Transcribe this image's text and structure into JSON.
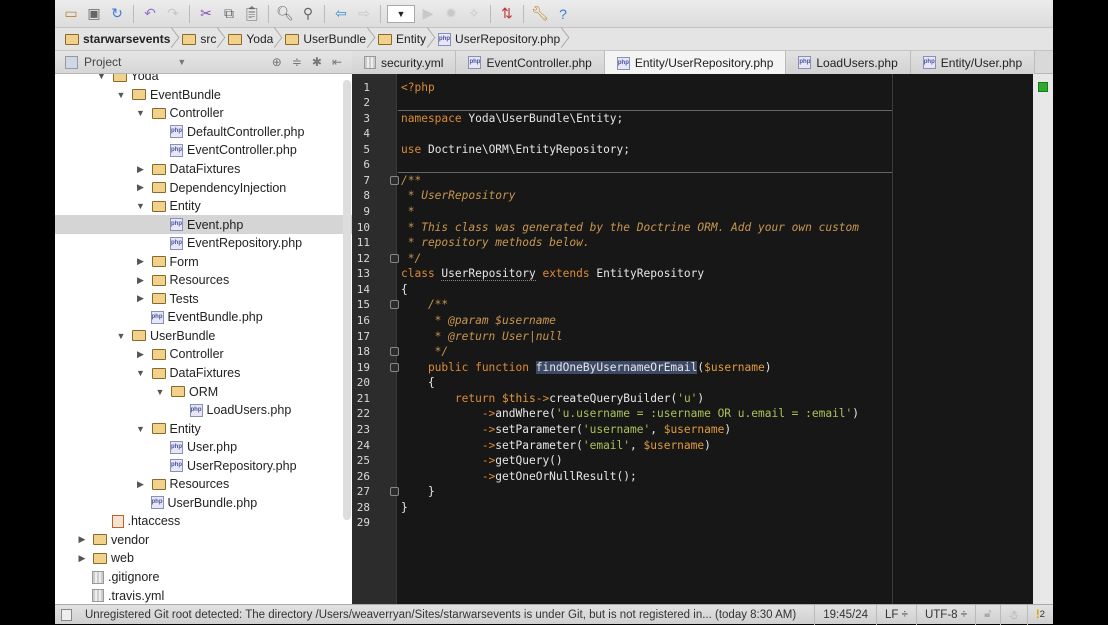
{
  "toolbar": {
    "icons": [
      "open-folder",
      "save",
      "sync",
      "undo",
      "redo",
      "cut",
      "copy",
      "paste",
      "find",
      "replace",
      "back",
      "forward",
      "run-config",
      "run",
      "debug",
      "coverage",
      "vcs",
      "settings",
      "help"
    ]
  },
  "breadcrumbs": [
    "starwarsevents",
    "src",
    "Yoda",
    "UserBundle",
    "Entity",
    "UserRepository.php"
  ],
  "project": {
    "label": "Project"
  },
  "tabs": [
    {
      "label": "security.yml",
      "type": "yml"
    },
    {
      "label": "EventController.php",
      "type": "php"
    },
    {
      "label": "Entity/UserRepository.php",
      "type": "php",
      "active": true
    },
    {
      "label": "LoadUsers.php",
      "type": "php"
    },
    {
      "label": "Entity/User.php",
      "type": "php"
    }
  ],
  "tree": [
    {
      "label": "Yoda",
      "depth": 1,
      "folder": true,
      "open": true
    },
    {
      "label": "EventBundle",
      "depth": 2,
      "folder": true,
      "open": true
    },
    {
      "label": "Controller",
      "depth": 3,
      "folder": true,
      "open": true
    },
    {
      "label": "DefaultController.php",
      "depth": 4
    },
    {
      "label": "EventController.php",
      "depth": 4
    },
    {
      "label": "DataFixtures",
      "depth": 3,
      "folder": true
    },
    {
      "label": "DependencyInjection",
      "depth": 3,
      "folder": true
    },
    {
      "label": "Entity",
      "depth": 3,
      "folder": true,
      "open": true
    },
    {
      "label": "Event.php",
      "depth": 4,
      "selected": true
    },
    {
      "label": "EventRepository.php",
      "depth": 4
    },
    {
      "label": "Form",
      "depth": 3,
      "folder": true
    },
    {
      "label": "Resources",
      "depth": 3,
      "folder": true
    },
    {
      "label": "Tests",
      "depth": 3,
      "folder": true
    },
    {
      "label": "EventBundle.php",
      "depth": 3
    },
    {
      "label": "UserBundle",
      "depth": 2,
      "folder": true,
      "open": true
    },
    {
      "label": "Controller",
      "depth": 3,
      "folder": true
    },
    {
      "label": "DataFixtures",
      "depth": 3,
      "folder": true,
      "open": true
    },
    {
      "label": "ORM",
      "depth": 4,
      "folder": true,
      "open": true
    },
    {
      "label": "LoadUsers.php",
      "depth": 5
    },
    {
      "label": "Entity",
      "depth": 3,
      "folder": true,
      "open": true
    },
    {
      "label": "User.php",
      "depth": 4
    },
    {
      "label": "UserRepository.php",
      "depth": 4
    },
    {
      "label": "Resources",
      "depth": 3,
      "folder": true
    },
    {
      "label": "UserBundle.php",
      "depth": 3
    },
    {
      "label": ".htaccess",
      "depth": 1,
      "kind": "htaccess"
    },
    {
      "label": "vendor",
      "depth": 0,
      "folder": true
    },
    {
      "label": "web",
      "depth": 0,
      "folder": true
    },
    {
      "label": ".gitignore",
      "depth": 0,
      "kind": "text"
    },
    {
      "label": ".travis.yml",
      "depth": 0,
      "kind": "text"
    }
  ],
  "code": [
    [
      [
        "<?php",
        "kw"
      ]
    ],
    [],
    [
      [
        "namespace ",
        "kw"
      ],
      [
        "Yoda\\UserBundle\\Entity;",
        ""
      ]
    ],
    [],
    [
      [
        "use ",
        "kw"
      ],
      [
        "Doctrine\\ORM\\EntityRepository;",
        ""
      ]
    ],
    [],
    [
      [
        "/**",
        "cm"
      ]
    ],
    [
      [
        " * UserRepository",
        "cm"
      ]
    ],
    [
      [
        " *",
        "cm"
      ]
    ],
    [
      [
        " * This class was generated by the Doctrine ORM. Add your own custom",
        "cm"
      ]
    ],
    [
      [
        " * repository methods below.",
        "cm"
      ]
    ],
    [
      [
        " */",
        "cm"
      ]
    ],
    [
      [
        "class ",
        "kw"
      ],
      [
        "UserRepository",
        "und"
      ],
      [
        " extends ",
        "kw"
      ],
      [
        "EntityRepository",
        ""
      ]
    ],
    [
      [
        "{",
        ""
      ]
    ],
    [
      [
        "    /**",
        "cm"
      ]
    ],
    [
      [
        "     * @param $username",
        "cm"
      ]
    ],
    [
      [
        "     * @return User|null",
        "cm"
      ]
    ],
    [
      [
        "     */",
        "cm"
      ]
    ],
    [
      [
        "    public function ",
        "kw"
      ],
      [
        "findOneByUsernameOrEmail",
        "hl"
      ],
      [
        "(",
        ""
      ],
      [
        "$username",
        "var"
      ],
      [
        ")",
        ""
      ]
    ],
    [
      [
        "    {",
        ""
      ]
    ],
    [
      [
        "        return ",
        "kw"
      ],
      [
        "$this",
        "var"
      ],
      [
        "->",
        "kw"
      ],
      [
        "createQueryBuilder(",
        ""
      ],
      [
        "'u'",
        "st"
      ],
      [
        ")",
        ""
      ]
    ],
    [
      [
        "            ->",
        "kw"
      ],
      [
        "andWhere(",
        ""
      ],
      [
        "'u.username = :username OR u.email = :email'",
        "st"
      ],
      [
        ")",
        ""
      ]
    ],
    [
      [
        "            ->",
        "kw"
      ],
      [
        "setParameter(",
        ""
      ],
      [
        "'username'",
        "st"
      ],
      [
        ", ",
        ""
      ],
      [
        "$username",
        "var"
      ],
      [
        ")",
        ""
      ]
    ],
    [
      [
        "            ->",
        "kw"
      ],
      [
        "setParameter(",
        ""
      ],
      [
        "'email'",
        "st"
      ],
      [
        ", ",
        ""
      ],
      [
        "$username",
        "var"
      ],
      [
        ")",
        ""
      ]
    ],
    [
      [
        "            ->",
        "kw"
      ],
      [
        "getQuery()",
        ""
      ]
    ],
    [
      [
        "            ->",
        "kw"
      ],
      [
        "getOneOrNullResult();",
        ""
      ]
    ],
    [
      [
        "    }",
        ""
      ]
    ],
    [
      [
        "}",
        ""
      ]
    ],
    []
  ],
  "status": {
    "message": "Unregistered Git root detected: The directory /Users/weaverryan/Sites/starwarsevents is under Git, but is not registered in... (today 8:30 AM)",
    "position": "19:45/24",
    "line_sep": "LF ÷",
    "encoding": "UTF-8 ÷",
    "warnings": "2"
  }
}
